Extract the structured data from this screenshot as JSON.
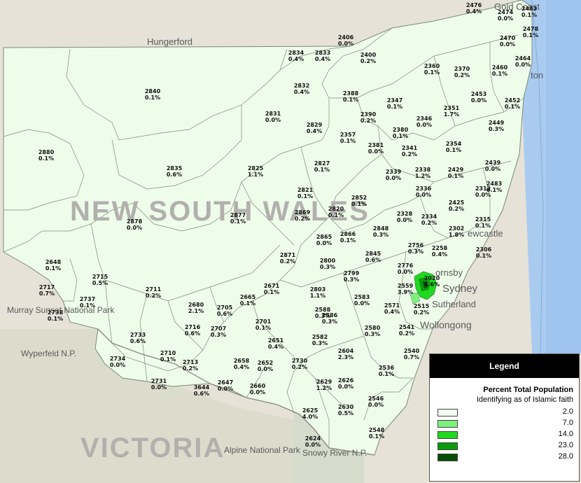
{
  "map": {
    "state_label_nsw": "NEW SOUTH WALES",
    "state_label_vic": "VICTORIA",
    "places": {
      "gold_coast": "Gold Coast",
      "hungerford": "Hungerford",
      "ballina_partial": "ton",
      "newcastle": "ewcastle",
      "hornsby": "ornsby",
      "sydney": "Sydney",
      "sutherland": "Sutherland",
      "wollongong": "Wollongong",
      "murray_sunset": "Murray Sunset National Park",
      "wyperfeld": "Wyperfeld N.P.",
      "alpine": "Alpine National Park",
      "snowy_river": "Snowy River N.P.",
      "victoria_text": "VICTORIA"
    },
    "postcodes": [
      {
        "code": "2476",
        "pct": "0.4%"
      },
      {
        "code": "2483",
        "pct": "0.1%"
      },
      {
        "code": "2474",
        "pct": "0.0%"
      },
      {
        "code": "2478",
        "pct": "0.1%"
      },
      {
        "code": "2470",
        "pct": "0.0%"
      },
      {
        "code": "2464",
        "pct": "0.0%"
      },
      {
        "code": "2406",
        "pct": "0.0%"
      },
      {
        "code": "2834",
        "pct": "0.4%"
      },
      {
        "code": "2833",
        "pct": "0.4%"
      },
      {
        "code": "2400",
        "pct": "0.2%"
      },
      {
        "code": "2360",
        "pct": "0.1%"
      },
      {
        "code": "2370",
        "pct": "0.2%"
      },
      {
        "code": "2460",
        "pct": "0.1%"
      },
      {
        "code": "2840",
        "pct": "0.1%"
      },
      {
        "code": "2832",
        "pct": "0.4%"
      },
      {
        "code": "2388",
        "pct": "0.1%"
      },
      {
        "code": "2347",
        "pct": "0.1%"
      },
      {
        "code": "2453",
        "pct": "0.0%"
      },
      {
        "code": "2452",
        "pct": "0.1%"
      },
      {
        "code": "2351",
        "pct": "1.7%"
      },
      {
        "code": "2831",
        "pct": "0.0%"
      },
      {
        "code": "2390",
        "pct": "0.2%"
      },
      {
        "code": "2346",
        "pct": "0.0%"
      },
      {
        "code": "2449",
        "pct": "0.3%"
      },
      {
        "code": "2829",
        "pct": "0.4%"
      },
      {
        "code": "2380",
        "pct": "0.1%"
      },
      {
        "code": "2357",
        "pct": "0.1%"
      },
      {
        "code": "2354",
        "pct": "0.1%"
      },
      {
        "code": "2880",
        "pct": "0.1%"
      },
      {
        "code": "2381",
        "pct": "0.0%"
      },
      {
        "code": "2341",
        "pct": "0.2%"
      },
      {
        "code": "2827",
        "pct": "0.1%"
      },
      {
        "code": "2439",
        "pct": "0.0%"
      },
      {
        "code": "2835",
        "pct": "0.6%"
      },
      {
        "code": "2825",
        "pct": "1.1%"
      },
      {
        "code": "2339",
        "pct": "0.0%"
      },
      {
        "code": "2338",
        "pct": "1.2%"
      },
      {
        "code": "2429",
        "pct": "0.1%"
      },
      {
        "code": "2483b",
        "pct": "0.1%"
      },
      {
        "code": "2312",
        "pct": "0.0%"
      },
      {
        "code": "2821",
        "pct": "0.1%"
      },
      {
        "code": "2336",
        "pct": "0.0%"
      },
      {
        "code": "2852",
        "pct": "0.1%"
      },
      {
        "code": "2425",
        "pct": "0.2%"
      },
      {
        "code": "2820",
        "pct": "0.1%"
      },
      {
        "code": "2877",
        "pct": "0.1%"
      },
      {
        "code": "2869",
        "pct": "0.2%"
      },
      {
        "code": "2328",
        "pct": "0.0%"
      },
      {
        "code": "2334",
        "pct": "0.2%"
      },
      {
        "code": "2315",
        "pct": "0.1%"
      },
      {
        "code": "2878",
        "pct": "0.0%"
      },
      {
        "code": "2848",
        "pct": "0.3%"
      },
      {
        "code": "2302",
        "pct": "1.8%"
      },
      {
        "code": "2865",
        "pct": "0.0%"
      },
      {
        "code": "2866",
        "pct": "0.1%"
      },
      {
        "code": "2756",
        "pct": "0.3%"
      },
      {
        "code": "2258",
        "pct": "0.4%"
      },
      {
        "code": "2306",
        "pct": "0.1%"
      },
      {
        "code": "2845",
        "pct": "0.6%"
      },
      {
        "code": "2648",
        "pct": "0.1%"
      },
      {
        "code": "2871",
        "pct": "0.2%"
      },
      {
        "code": "2800",
        "pct": "0.3%"
      },
      {
        "code": "2776",
        "pct": "0.0%"
      },
      {
        "code": "2715",
        "pct": "0.5%"
      },
      {
        "code": "2799",
        "pct": "0.3%"
      },
      {
        "code": "2020",
        "pct": "4.6%"
      },
      {
        "code": "2717",
        "pct": "0.7%"
      },
      {
        "code": "2711",
        "pct": "0.2%"
      },
      {
        "code": "2671",
        "pct": "0.1%"
      },
      {
        "code": "2803",
        "pct": "1.1%"
      },
      {
        "code": "2559",
        "pct": "3.9%"
      },
      {
        "code": "2737",
        "pct": "0.1%"
      },
      {
        "code": "2665",
        "pct": "0.1%"
      },
      {
        "code": "2583",
        "pct": "0.0%"
      },
      {
        "code": "2515",
        "pct": "0.2%"
      },
      {
        "code": "2680",
        "pct": "2.1%"
      },
      {
        "code": "2705",
        "pct": "0.6%"
      },
      {
        "code": "2571",
        "pct": "0.4%"
      },
      {
        "code": "2738",
        "pct": "0.1%"
      },
      {
        "code": "2588",
        "pct": "0.3%"
      },
      {
        "code": "2586",
        "pct": "0.3%"
      },
      {
        "code": "2701",
        "pct": "0.1%"
      },
      {
        "code": "2541",
        "pct": "0.2%"
      },
      {
        "code": "2716",
        "pct": "0.6%"
      },
      {
        "code": "2707",
        "pct": "0.3%"
      },
      {
        "code": "2580",
        "pct": "0.3%"
      },
      {
        "code": "2733",
        "pct": "0.6%"
      },
      {
        "code": "2651",
        "pct": "0.4%"
      },
      {
        "code": "2582",
        "pct": "0.3%"
      },
      {
        "code": "2540",
        "pct": "0.7%"
      },
      {
        "code": "2710",
        "pct": "0.1%"
      },
      {
        "code": "2604",
        "pct": "2.3%"
      },
      {
        "code": "2734",
        "pct": "0.0%"
      },
      {
        "code": "2713",
        "pct": "0.2%"
      },
      {
        "code": "2658",
        "pct": "0.4%"
      },
      {
        "code": "2652",
        "pct": "0.0%"
      },
      {
        "code": "2730",
        "pct": "0.2%"
      },
      {
        "code": "2536",
        "pct": "0.1%"
      },
      {
        "code": "2731",
        "pct": "0.0%"
      },
      {
        "code": "3644",
        "pct": "0.6%"
      },
      {
        "code": "2647",
        "pct": "0.0%"
      },
      {
        "code": "2660",
        "pct": "0.0%"
      },
      {
        "code": "2629",
        "pct": "1.2%"
      },
      {
        "code": "2626",
        "pct": "0.0%"
      },
      {
        "code": "2546",
        "pct": "0.0%"
      },
      {
        "code": "2625",
        "pct": "4.0%"
      },
      {
        "code": "2630",
        "pct": "0.5%"
      },
      {
        "code": "2548",
        "pct": "0.1%"
      },
      {
        "code": "2624",
        "pct": "0.0%"
      }
    ]
  },
  "legend": {
    "header": "Legend",
    "title": "Percent Total Population",
    "subtitle": "Identifying as of Islamic faith",
    "classes": [
      {
        "value": "2.0",
        "color": "#f0fff0"
      },
      {
        "value": "7.0",
        "color": "#7cf07c"
      },
      {
        "value": "14.0",
        "color": "#1fd81f"
      },
      {
        "value": "23.0",
        "color": "#0a9a0a"
      },
      {
        "value": "28.0",
        "color": "#064e06"
      }
    ]
  }
}
